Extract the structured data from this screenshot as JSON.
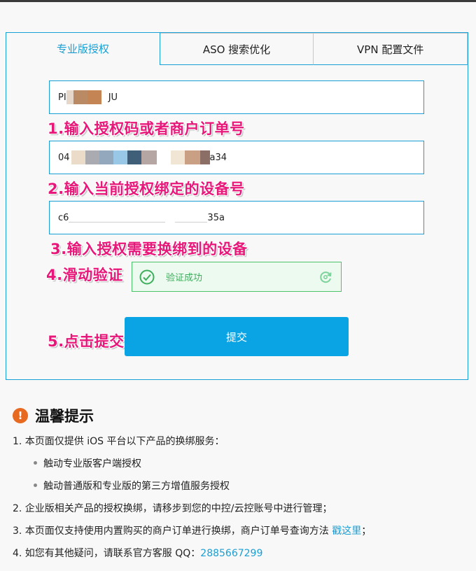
{
  "tabs": [
    {
      "label": "专业版授权",
      "active": true
    },
    {
      "label": "ASO 搜索优化",
      "active": false
    },
    {
      "label": "VPN 配置文件",
      "active": false
    }
  ],
  "form": {
    "auth_code_value": "PI",
    "auth_code_suffix": "JU",
    "device_id_value": "04",
    "device_id_suffix": "a34",
    "new_device_value": "c6",
    "new_device_suffix": "35a",
    "submit_label": "提交"
  },
  "steps": {
    "s1": "1.输入授权码或者商户订单号",
    "s2": "2.输入当前授权绑定的设备号",
    "s3": "3.输入授权需要换绑到的设备",
    "s4": "4.滑动验证",
    "s5": "5.点击提交"
  },
  "captcha": {
    "status_text": "验证成功"
  },
  "tips": {
    "title": "温馨提示",
    "warn_glyph": "!",
    "l1": "1. 本页面仅提供 iOS 平台以下产品的换绑服务：",
    "l1a": "触动专业版客户端授权",
    "l1b": "触动普通版和专业版的第三方增值服务授权",
    "l2": "2. 企业版相关产品的授权换绑，请移步到您的中控/云控账号中进行管理；",
    "l3": "3. 本页面仅支持使用内置购买的商户订单进行换绑，商户订单号查询方法 ",
    "l3_link": "戳这里",
    "l3_end": "；",
    "l4": "4. 如您有其他疑问，请联系官方客服 QQ：",
    "l4_qq": "2885667299"
  },
  "colors": {
    "accent": "#1a9fd4",
    "button": "#0aa3e3",
    "step_text": "#e8177a",
    "success": "#3fae5c",
    "warning": "#e86a21"
  }
}
